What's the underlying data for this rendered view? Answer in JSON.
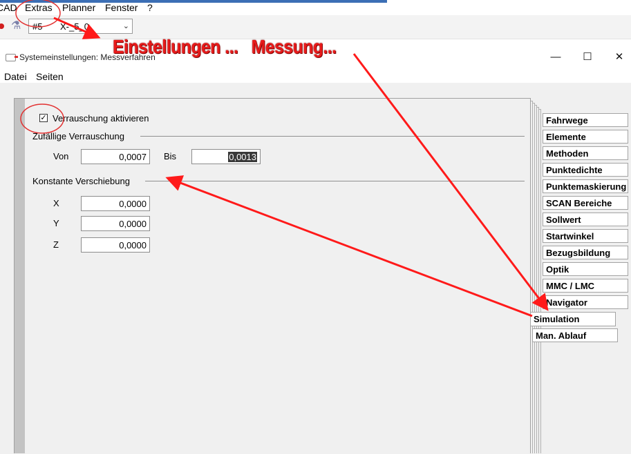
{
  "app": {
    "menu": [
      "CAD",
      "Extras",
      "Planner",
      "Fenster",
      "?"
    ],
    "combo": {
      "value_left": "#5",
      "value_right": "X-_5_0"
    }
  },
  "dialog": {
    "title": "Systemeinstellungen: Messverfahren",
    "window_buttons": {
      "minimize": "—",
      "maximize": "☐",
      "close": "✕"
    },
    "menu": [
      "Datei",
      "Seiten"
    ],
    "checkbox": {
      "label": "Verrauschung aktivieren",
      "checked": true,
      "mark": "✓"
    },
    "random_group": {
      "label": "Zufällige Verrauschung",
      "von_label": "Von",
      "von_value": "0,0007",
      "bis_label": "Bis",
      "bis_value": "0,0013"
    },
    "constant_group": {
      "label": "Konstante Verschiebung",
      "x_label": "X",
      "x_value": "0,0000",
      "y_label": "Y",
      "y_value": "0,0000",
      "z_label": "Z",
      "z_value": "0,0000"
    },
    "tabs": [
      "Fahrwege",
      "Elemente",
      "Methoden",
      "Punktedichte",
      "Punktemaskierung",
      "SCAN Bereiche",
      "Sollwert",
      "Startwinkel",
      "Bezugsbildung",
      "Optik",
      "MMC / LMC",
      "Navigator"
    ],
    "tab_selected": "Simulation",
    "tab_extra": "Man. Ablauf"
  },
  "annotation": {
    "text": "Einstellungen ...   Messung...",
    "color": "#e81b1b"
  }
}
